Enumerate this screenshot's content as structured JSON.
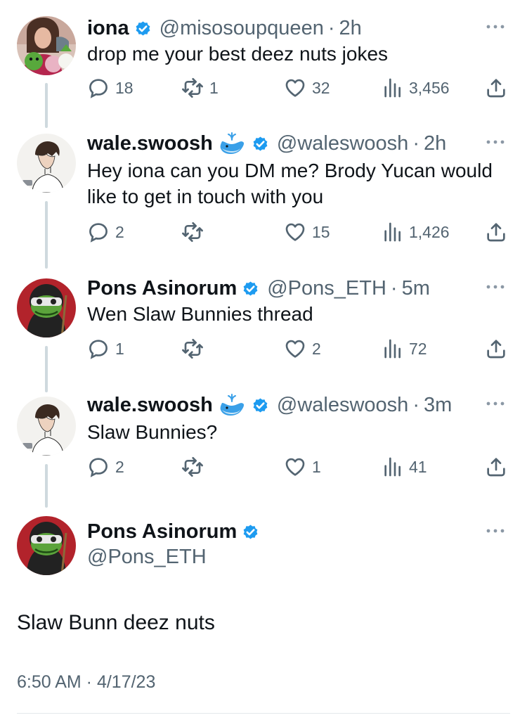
{
  "colors": {
    "text": "#0f1419",
    "secondary": "#536471",
    "verified": "#1d9bf0",
    "thread": "#cfd9de"
  },
  "tweets": [
    {
      "name": "iona",
      "handle": "@misosoupqueen",
      "time": "2h",
      "text": "drop me your best deez nuts jokes",
      "replies": "18",
      "retweets": "1",
      "likes": "32",
      "views": "3,456"
    },
    {
      "name": "wale.swoosh",
      "handle": "@waleswoosh",
      "time": "2h",
      "text": "Hey iona can you DM me? Brody Yucan would like to get in touch with you",
      "replies": "2",
      "retweets": "",
      "likes": "15",
      "views": "1,426"
    },
    {
      "name": "Pons Asinorum",
      "handle": "@Pons_ETH",
      "time": "5m",
      "text": "Wen Slaw Bunnies thread",
      "replies": "1",
      "retweets": "",
      "likes": "2",
      "views": "72"
    },
    {
      "name": "wale.swoosh",
      "handle": "@waleswoosh",
      "time": "3m",
      "text": "Slaw Bunnies?",
      "replies": "2",
      "retweets": "",
      "likes": "1",
      "views": "41"
    }
  ],
  "main_tweet": {
    "name": "Pons Asinorum",
    "handle": "@Pons_ETH",
    "text": "Slaw Bunn deez nuts",
    "timestamp": "6:50 AM · 4/17/23"
  },
  "separator": "·",
  "icons": {
    "verified": "verified-badge-icon",
    "whale": "whale-emoji-icon",
    "more": "more-dots-icon",
    "reply": "reply-icon",
    "retweet": "retweet-icon",
    "like": "like-heart-icon",
    "views": "views-chart-icon",
    "share": "share-icon"
  }
}
